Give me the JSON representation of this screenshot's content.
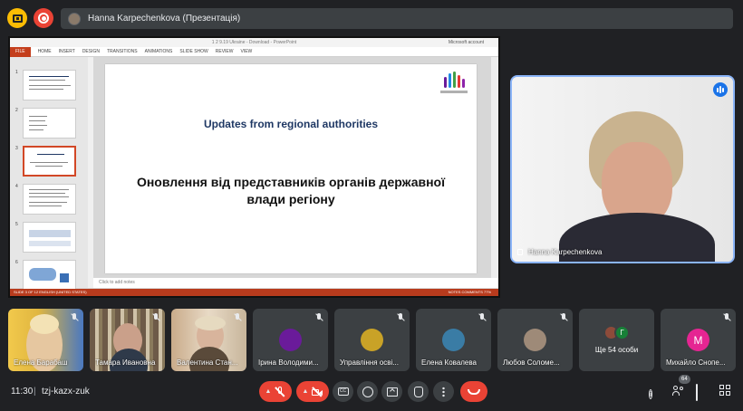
{
  "topbar": {
    "presenter_label": "Hanna Karpechenkova (Презентація)",
    "icons": [
      "presentation-icon",
      "recording-icon"
    ]
  },
  "powerpoint": {
    "window_title": "1 2 9.19 Ukraine - Download - PowerPoint",
    "account": "Microsoft account",
    "ribbon_tabs": [
      "FILE",
      "HOME",
      "INSERT",
      "DESIGN",
      "TRANSITIONS",
      "ANIMATIONS",
      "SLIDE SHOW",
      "REVIEW",
      "VIEW"
    ],
    "thumb_numbers": [
      "1",
      "2",
      "3",
      "4",
      "5",
      "6"
    ],
    "active_slide": 3,
    "slide": {
      "title_en": "Updates from regional authorities",
      "title_uk": "Оновлення від представників органів державної влади регіону"
    },
    "notes_placeholder": "Click to add notes",
    "status_left": "SLIDE 3 OF 12     ENGLISH (UNITED STATES)",
    "status_right": "NOTES   COMMENTS          77%"
  },
  "speaker": {
    "name": "Hanna Karpechenkova"
  },
  "participants": [
    {
      "name": "Елена Барабаш",
      "type": "video",
      "muted": true
    },
    {
      "name": "Тамара Ивановна",
      "type": "video",
      "muted": true
    },
    {
      "name": "Валентина Стан...",
      "type": "video",
      "muted": true
    },
    {
      "name": "Ірина Володими...",
      "type": "avatar",
      "muted": true,
      "color": "#6a1b9a"
    },
    {
      "name": "Управління осві...",
      "type": "avatar",
      "muted": true,
      "color": "#c9a227"
    },
    {
      "name": "Елена Ковалева",
      "type": "avatar",
      "muted": true,
      "color": "#3a7ca5"
    },
    {
      "name": "Любов Соломе...",
      "type": "avatar",
      "muted": true,
      "color": "#9e8a78"
    },
    {
      "name": "Ще 54 особи",
      "type": "others",
      "initial": "Г"
    },
    {
      "name": "Михайло Снопе...",
      "type": "letter",
      "muted": true,
      "letter": "М",
      "color": "#e52592"
    }
  ],
  "bottombar": {
    "time": "11:30",
    "separator": "|",
    "meeting_code": "tzj-kazx-zuk",
    "participants_badge": "64",
    "controls": [
      "microphone-off-icon",
      "camera-off-icon",
      "captions-icon",
      "emoji-icon",
      "present-icon",
      "raise-hand-icon",
      "more-options-icon",
      "end-call-icon"
    ],
    "right_icons": [
      "info-icon",
      "people-icon",
      "chat-icon",
      "activities-icon"
    ]
  },
  "colors": {
    "background": "#202124",
    "surface": "#3c4043",
    "danger": "#ea4335",
    "accent": "#8ab4f8",
    "powerpoint": "#c43e1c"
  }
}
